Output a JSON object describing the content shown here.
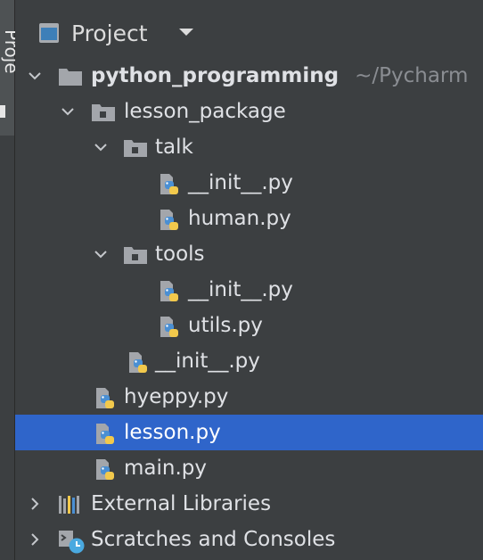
{
  "sidebar": {
    "tab_label": "Proje"
  },
  "header": {
    "title": "Project"
  },
  "tree": {
    "root": {
      "name": "python_programming",
      "path": "~/Pycharm"
    },
    "lesson_package": {
      "name": "lesson_package"
    },
    "talk": {
      "name": "talk"
    },
    "talk_init": {
      "name": "__init__.py"
    },
    "talk_human": {
      "name": "human.py"
    },
    "tools": {
      "name": "tools"
    },
    "tools_init": {
      "name": "__init__.py"
    },
    "tools_utils": {
      "name": "utils.py"
    },
    "package_init": {
      "name": "__init__.py"
    },
    "hyeppy": {
      "name": "hyeppy.py"
    },
    "lesson": {
      "name": "lesson.py"
    },
    "main": {
      "name": "main.py"
    },
    "external_libraries": {
      "name": "External Libraries"
    },
    "scratches": {
      "name": "Scratches and Consoles"
    }
  },
  "colors": {
    "background": "#3c3f41",
    "selection": "#2f65ca",
    "folder": "#a3a6ab",
    "python_blue": "#4a8fd3",
    "python_yellow": "#f2c94c",
    "muted_text": "#8a8d92"
  },
  "icons": {
    "project_view": "project-view-icon",
    "folder": "folder-icon",
    "package": "package-icon",
    "python_file": "python-file-icon",
    "libraries": "libraries-icon",
    "scratches": "scratches-icon"
  }
}
